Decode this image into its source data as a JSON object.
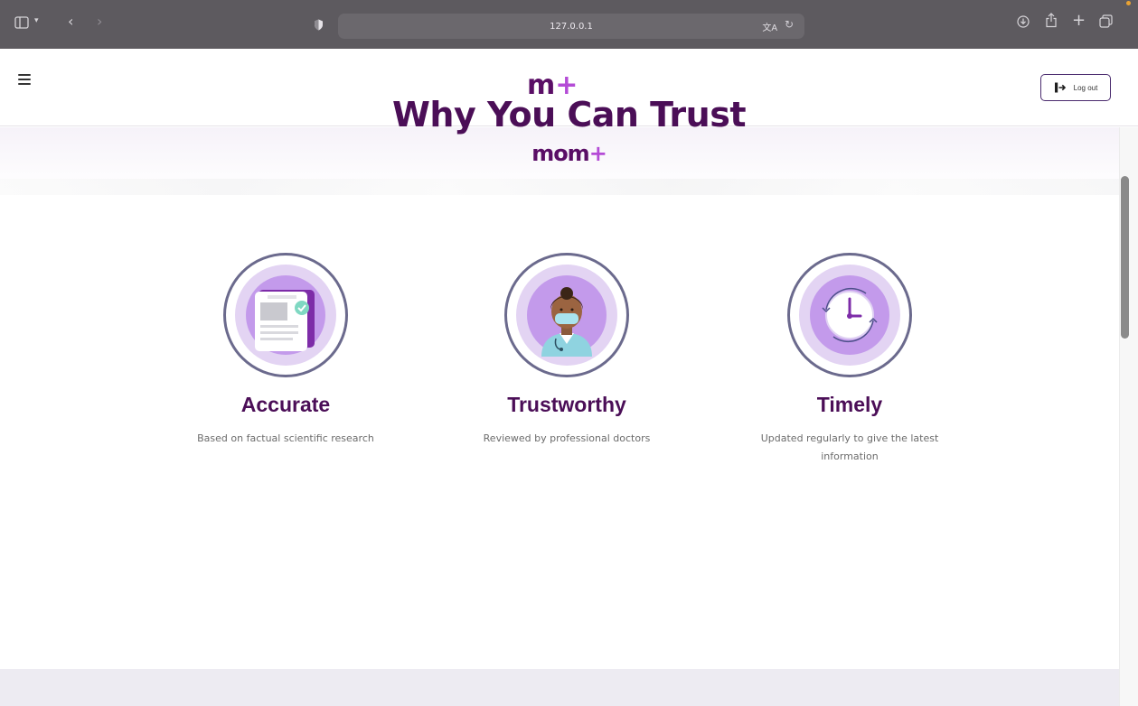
{
  "browser": {
    "url": "127.0.0.1",
    "icons": [
      "sidebar-icon",
      "chevron-down-icon",
      "back-icon",
      "forward-icon",
      "privacy-shield-icon",
      "translate-icon",
      "reload-icon",
      "download-icon",
      "share-icon",
      "new-tab-icon",
      "tabs-overview-icon"
    ]
  },
  "header": {
    "logo_main": "m",
    "logo_plus": "+",
    "logout_label": "Log out"
  },
  "hero": {
    "title": "Why You Can Trust",
    "brand_main": "mom",
    "brand_plus": "+"
  },
  "features": [
    {
      "title": "Accurate",
      "description": "Based on factual scientific research",
      "icon": "document-check-icon"
    },
    {
      "title": "Trustworthy",
      "description": "Reviewed by professional doctors",
      "icon": "doctor-icon"
    },
    {
      "title": "Timely",
      "description": "Updated regularly to give the latest information",
      "icon": "clock-icon"
    }
  ],
  "colors": {
    "brand_purple": "#4b0e57",
    "brand_plus": "#b44bd6",
    "badge_fill": "#c39aeb",
    "badge_ring": "#e3d4f3",
    "browser_bar": "#5d5a5f"
  }
}
